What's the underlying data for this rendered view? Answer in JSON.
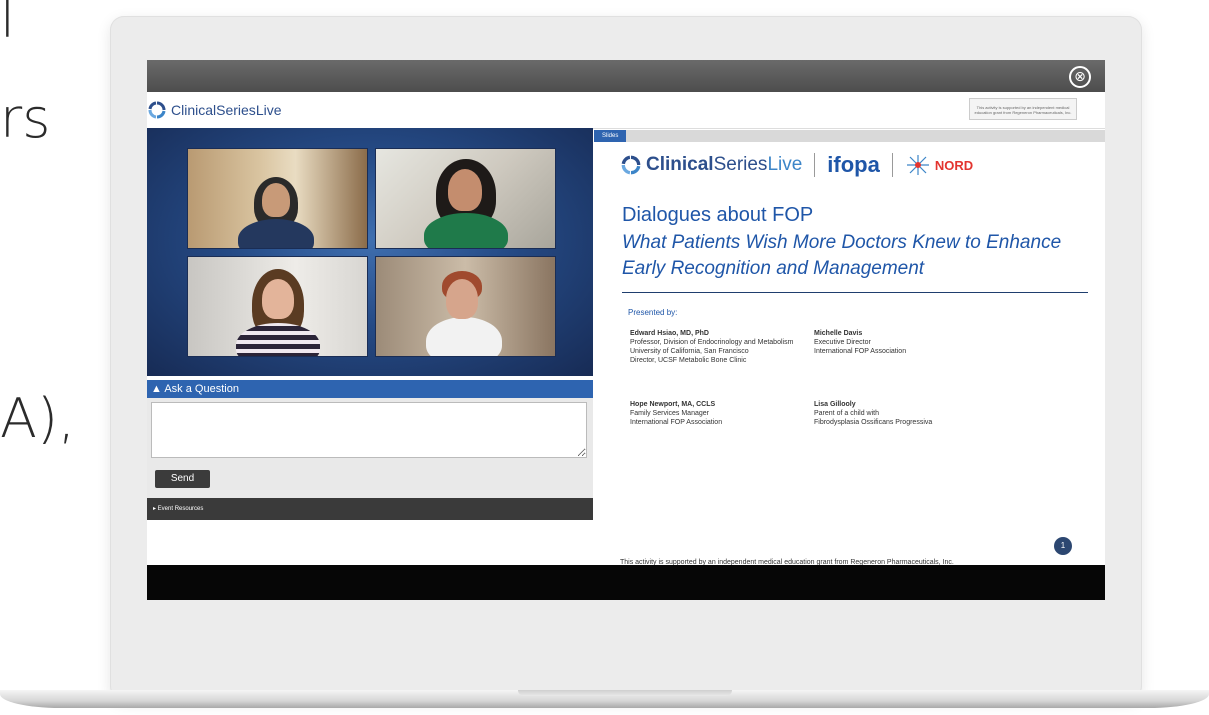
{
  "background_text": {
    "line1": "l",
    "line2": "rs",
    "line3": "A),"
  },
  "window": {
    "close_glyph": "⊗"
  },
  "header": {
    "brand_bold": "ClinicalSeries",
    "brand_light": "Live",
    "support_note": "This activity is supported by an independent medical education grant from Regeneron Pharmaceuticals, Inc."
  },
  "ask": {
    "label": "▲ Ask a Question",
    "input_value": "",
    "send_label": "Send"
  },
  "event_resources": {
    "label": "▸ Event Resources"
  },
  "slides_tab": {
    "label": "Slides"
  },
  "slide": {
    "logo1_bold": "Clinical",
    "logo1_mid": "Series",
    "logo1_light": "Live",
    "logo2": "ifopa",
    "logo3": "NORD",
    "title": "Dialogues about FOP",
    "subtitle": "What Patients Wish More Doctors Knew to Enhance Early Recognition and Management",
    "presented_by": "Presented by:",
    "presenters": [
      {
        "name": "Edward Hsiao, MD, PhD",
        "line1": "Professor, Division of Endocrinology and Metabolism",
        "line2": "University of California, San Francisco",
        "line3": "Director, UCSF Metabolic Bone Clinic"
      },
      {
        "name": "Michelle Davis",
        "line1": "Executive Director",
        "line2": "International FOP Association",
        "line3": ""
      },
      {
        "name": "Hope Newport, MA, CCLS",
        "line1": "Family Services Manager",
        "line2": "International FOP Association",
        "line3": ""
      },
      {
        "name": "Lisa Gillooly",
        "line1": "Parent of a child with",
        "line2": "Fibrodysplasia Ossificans Progressiva",
        "line3": ""
      }
    ],
    "footer": "This activity is supported by an independent medical education grant from Regeneron Pharmaceuticals, Inc.",
    "page_number": "1"
  },
  "colors": {
    "brand_blue": "#2d4f8c",
    "slide_blue": "#1f56a8",
    "bar_blue": "#2e64b0",
    "nord_red": "#e3342f"
  }
}
